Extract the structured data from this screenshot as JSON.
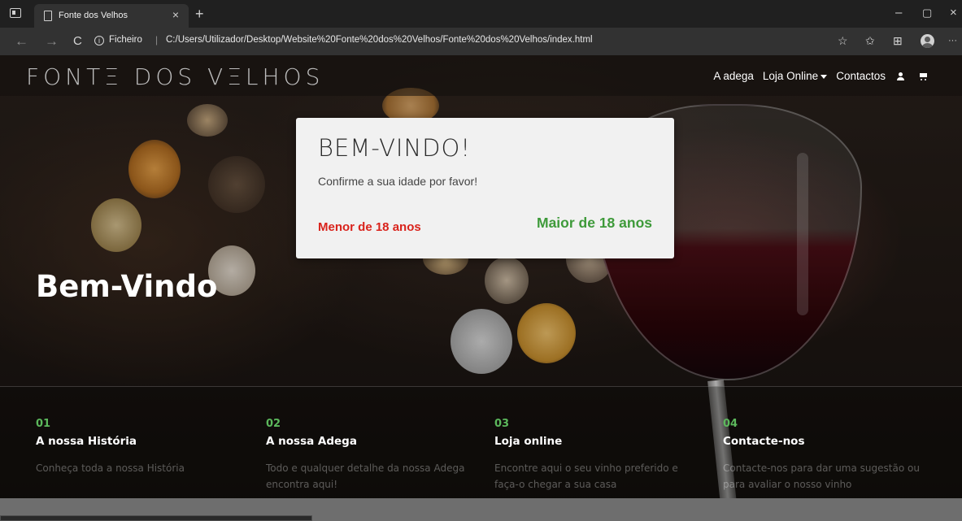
{
  "browser": {
    "tab_title": "Fonte dos Velhos",
    "tab_close": "×",
    "new_tab": "+",
    "window_controls": [
      "–",
      "▢",
      "×"
    ],
    "back": "←",
    "forward": "→",
    "reload": "C",
    "address_label": "Ficheiro",
    "address_separator": "|",
    "url": "C:/Users/Utilizador/Desktop/Website%20Fonte%20dos%20Velhos/Fonte%20dos%20Velhos/index.html",
    "toolbar_icons": [
      "read-aloud-icon",
      "favorites-icon",
      "collections-icon",
      "profile-icon",
      "more-icon"
    ],
    "more": "···"
  },
  "site": {
    "logo": "FONTΞ DOS VΞLHOS",
    "nav": {
      "adega": "A adega",
      "loja": "Loja Online",
      "contactos": "Contactos"
    },
    "hero_title": "Bem-Vindo",
    "features": [
      {
        "num": "01",
        "title": "A nossa História",
        "desc": "Conheça toda a nossa História"
      },
      {
        "num": "02",
        "title": "A nossa Adega",
        "desc": "Todo e qualquer detalhe da nossa Adega encontra aqui!"
      },
      {
        "num": "03",
        "title": "Loja online",
        "desc": "Encontre aqui o seu vinho preferido e faça-o chegar a sua casa"
      },
      {
        "num": "04",
        "title": "Contacte-nos",
        "desc": "Contacte-nos para dar uma sugestão ou para avaliar o nosso vinho"
      }
    ]
  },
  "modal": {
    "title": "BEM-VINDO!",
    "subtitle": "Confirme a sua idade por favor!",
    "under_label": "Menor de 18 anos",
    "over_label": "Maior de 18 anos"
  },
  "colors": {
    "accent_green": "#5cb85c",
    "under_red": "#d9231c",
    "over_green": "#3e9a3a"
  }
}
